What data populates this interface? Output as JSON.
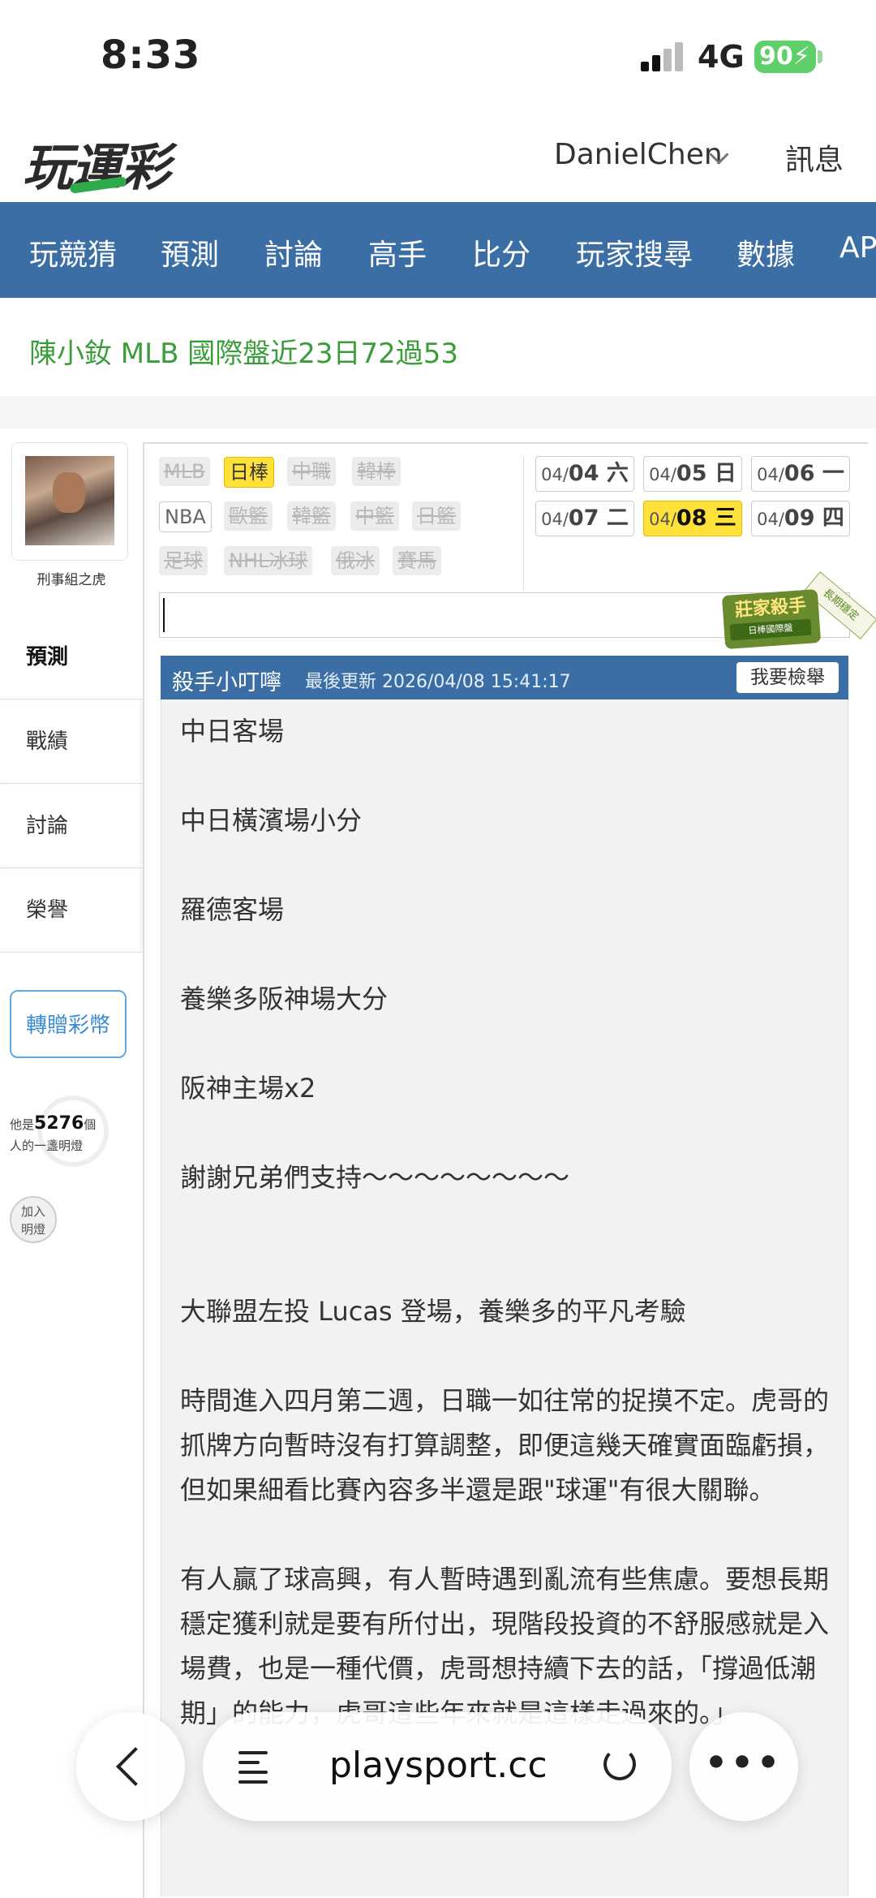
{
  "status_bar": {
    "time": "8:33",
    "network": "4G",
    "battery": "90"
  },
  "header": {
    "logo": "玩運彩",
    "username": "DanielChen",
    "messages_label": "訊息"
  },
  "nav": {
    "items": [
      "玩競猜",
      "預測",
      "討論",
      "高手",
      "比分",
      "玩家搜尋",
      "數據",
      "AP"
    ]
  },
  "ticker": {
    "text": "陳小釹  MLB  國際盤近23日72過53"
  },
  "profile": {
    "name": "刑事組之虎"
  },
  "side_tabs": [
    "預測",
    "戰績",
    "討論",
    "榮譽"
  ],
  "gift_button": "轉贈彩幣",
  "lamp": {
    "prefix": "他是",
    "count": "5276",
    "suffix": "個",
    "line2": "人的一盞明燈",
    "join_line1": "加入",
    "join_line2": "明燈"
  },
  "leagues": [
    {
      "label": "MLB",
      "state": "disabled"
    },
    {
      "label": "日棒",
      "state": "active"
    },
    {
      "label": "中職",
      "state": "disabled"
    },
    {
      "label": "韓棒",
      "state": "disabled"
    },
    {
      "label": "NBA",
      "state": "plain"
    },
    {
      "label": "歐籃",
      "state": "disabled"
    },
    {
      "label": "韓籃",
      "state": "disabled"
    },
    {
      "label": "中籃",
      "state": "disabled"
    },
    {
      "label": "日籃",
      "state": "disabled"
    },
    {
      "label": "足球",
      "state": "disabled"
    },
    {
      "label": "NHL冰球",
      "state": "disabled"
    },
    {
      "label": "俄冰",
      "state": "disabled"
    },
    {
      "label": "賽馬",
      "state": "disabled"
    }
  ],
  "dates": [
    {
      "month": "04/",
      "day": "04",
      "weekday": "六",
      "active": false
    },
    {
      "month": "04/",
      "day": "05",
      "weekday": "日",
      "active": false
    },
    {
      "month": "04/",
      "day": "06",
      "weekday": "一",
      "active": false
    },
    {
      "month": "04/",
      "day": "07",
      "weekday": "二",
      "active": false
    },
    {
      "month": "04/",
      "day": "08",
      "weekday": "三",
      "active": true
    },
    {
      "month": "04/",
      "day": "09",
      "weekday": "四",
      "active": false
    }
  ],
  "badge": {
    "title": "莊家殺手",
    "subtitle": "日棒國際盤",
    "ribbon": "長期穩定"
  },
  "post": {
    "author": "殺手小叮嚀",
    "updated": "最後更新 2026/04/08 15:41:17",
    "report_label": "我要檢舉",
    "paragraphs": [
      "中日客場",
      "中日橫濱場小分",
      "羅德客場",
      "養樂多阪神場大分",
      "阪神主場x2",
      "謝謝兄弟們支持～～～～～～～～",
      "大聯盟左投 Lucas 登場，養樂多的平凡考驗",
      "時間進入四月第二週，日職一如往常的捉摸不定。虎哥的抓牌方向暫時沒有打算調整，即便這幾天確實面臨虧損，但如果細看比賽內容多半還是跟\"球運\"有很大關聯。",
      "有人贏了球高興，有人暫時遇到亂流有些焦慮。要想長期穩定獲利就是要有所付出，現階段投資的不舒服感就是入場費，也是一種代價，虎哥想持續下去的話，「撐過低潮期」的能力，虎哥這些年來就是這樣走過來的。」"
    ]
  },
  "browser": {
    "url": "playsport.cc"
  }
}
